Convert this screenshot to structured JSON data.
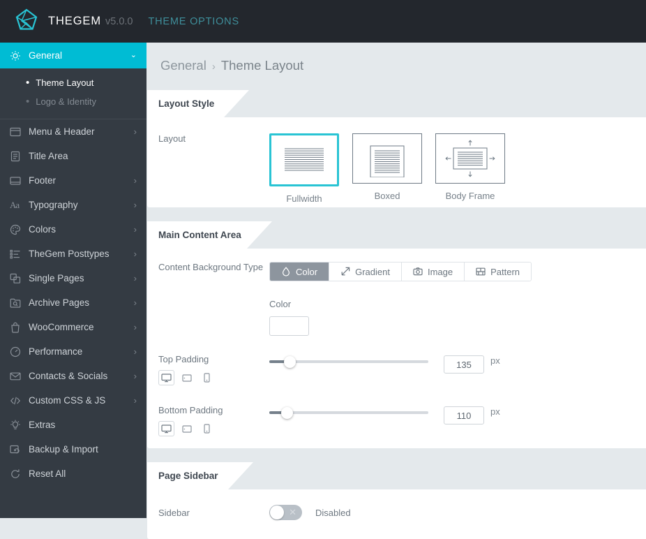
{
  "topbar": {
    "logo_icon": "gem-pentagon-logo",
    "brand": "THEGEM",
    "version": "v5.0.0",
    "theme_options": "THEME OPTIONS",
    "accent_color": "#00bcd4",
    "bg_color": "#23272d"
  },
  "breadcrumb": {
    "parent": "General",
    "separator": "›",
    "current": "Theme Layout"
  },
  "sidebar": {
    "bg_color": "#343b43",
    "active_color": "#00bcd4",
    "items": [
      {
        "label": "General",
        "icon": "gear-icon",
        "chevron": "⌄",
        "active": true
      },
      {
        "label": "Menu & Header",
        "icon": "window-icon",
        "chevron": "›",
        "active": false
      },
      {
        "label": "Title Area",
        "icon": "document-icon",
        "chevron": "",
        "active": false
      },
      {
        "label": "Footer",
        "icon": "footer-icon",
        "chevron": "›",
        "active": false
      },
      {
        "label": "Typography",
        "icon": "typography-aa-icon",
        "chevron": "›",
        "active": false
      },
      {
        "label": "Colors",
        "icon": "palette-icon",
        "chevron": "›",
        "active": false
      },
      {
        "label": "TheGem Posttypes",
        "icon": "list-icon",
        "chevron": "›",
        "active": false
      },
      {
        "label": "Single Pages",
        "icon": "stacked-pages-icon",
        "chevron": "›",
        "active": false
      },
      {
        "label": "Archive Pages",
        "icon": "folder-search-icon",
        "chevron": "›",
        "active": false
      },
      {
        "label": "WooCommerce",
        "icon": "shopping-bag-icon",
        "chevron": "›",
        "active": false
      },
      {
        "label": "Performance",
        "icon": "speedometer-icon",
        "chevron": "›",
        "active": false
      },
      {
        "label": "Contacts & Socials",
        "icon": "envelope-icon",
        "chevron": "›",
        "active": false
      },
      {
        "label": "Custom CSS & JS",
        "icon": "code-brackets-icon",
        "chevron": "›",
        "active": false
      },
      {
        "label": "Extras",
        "icon": "lightbulb-icon",
        "chevron": "",
        "active": false
      },
      {
        "label": "Backup & Import",
        "icon": "backup-restore-icon",
        "chevron": "",
        "active": false
      },
      {
        "label": "Reset All",
        "icon": "reset-circle-icon",
        "chevron": "",
        "active": false
      }
    ],
    "submenu": [
      {
        "label": "Theme Layout",
        "current": true
      },
      {
        "label": "Logo & Identity",
        "current": false
      }
    ]
  },
  "layout_style": {
    "section_title": "Layout Style",
    "row_label": "Layout",
    "options": [
      {
        "label": "Fullwidth",
        "icon": "fullwidth-layout-icon",
        "selected": true
      },
      {
        "label": "Boxed",
        "icon": "boxed-layout-icon",
        "selected": false
      },
      {
        "label": "Body Frame",
        "icon": "body-frame-layout-icon",
        "selected": false
      }
    ],
    "selected_border_color": "#29c4d4"
  },
  "main_content_area": {
    "section_title": "Main Content Area",
    "bg_type_label": "Content Background Type",
    "bg_types": [
      {
        "label": "Color",
        "icon": "droplet-icon",
        "active": true
      },
      {
        "label": "Gradient",
        "icon": "gradient-arrow-icon",
        "active": false
      },
      {
        "label": "Image",
        "icon": "camera-icon",
        "active": false
      },
      {
        "label": "Pattern",
        "icon": "pattern-grid-icon",
        "active": false
      }
    ],
    "color_field_label": "Color",
    "color_value": "#ffffff",
    "top_padding": {
      "label": "Top Padding",
      "value": "135",
      "unit": "px",
      "slider_percent": 13,
      "devices": [
        {
          "icon": "desktop-icon",
          "selected": true
        },
        {
          "icon": "tablet-icon",
          "selected": false
        },
        {
          "icon": "mobile-icon",
          "selected": false
        }
      ]
    },
    "bottom_padding": {
      "label": "Bottom Padding",
      "value": "110",
      "unit": "px",
      "slider_percent": 11,
      "devices": [
        {
          "icon": "desktop-icon",
          "selected": true
        },
        {
          "icon": "tablet-icon",
          "selected": false
        },
        {
          "icon": "mobile-icon",
          "selected": false
        }
      ]
    }
  },
  "page_sidebar": {
    "section_title": "Page Sidebar",
    "row_label": "Sidebar",
    "toggle_state": "Disabled",
    "toggle_on": false
  }
}
